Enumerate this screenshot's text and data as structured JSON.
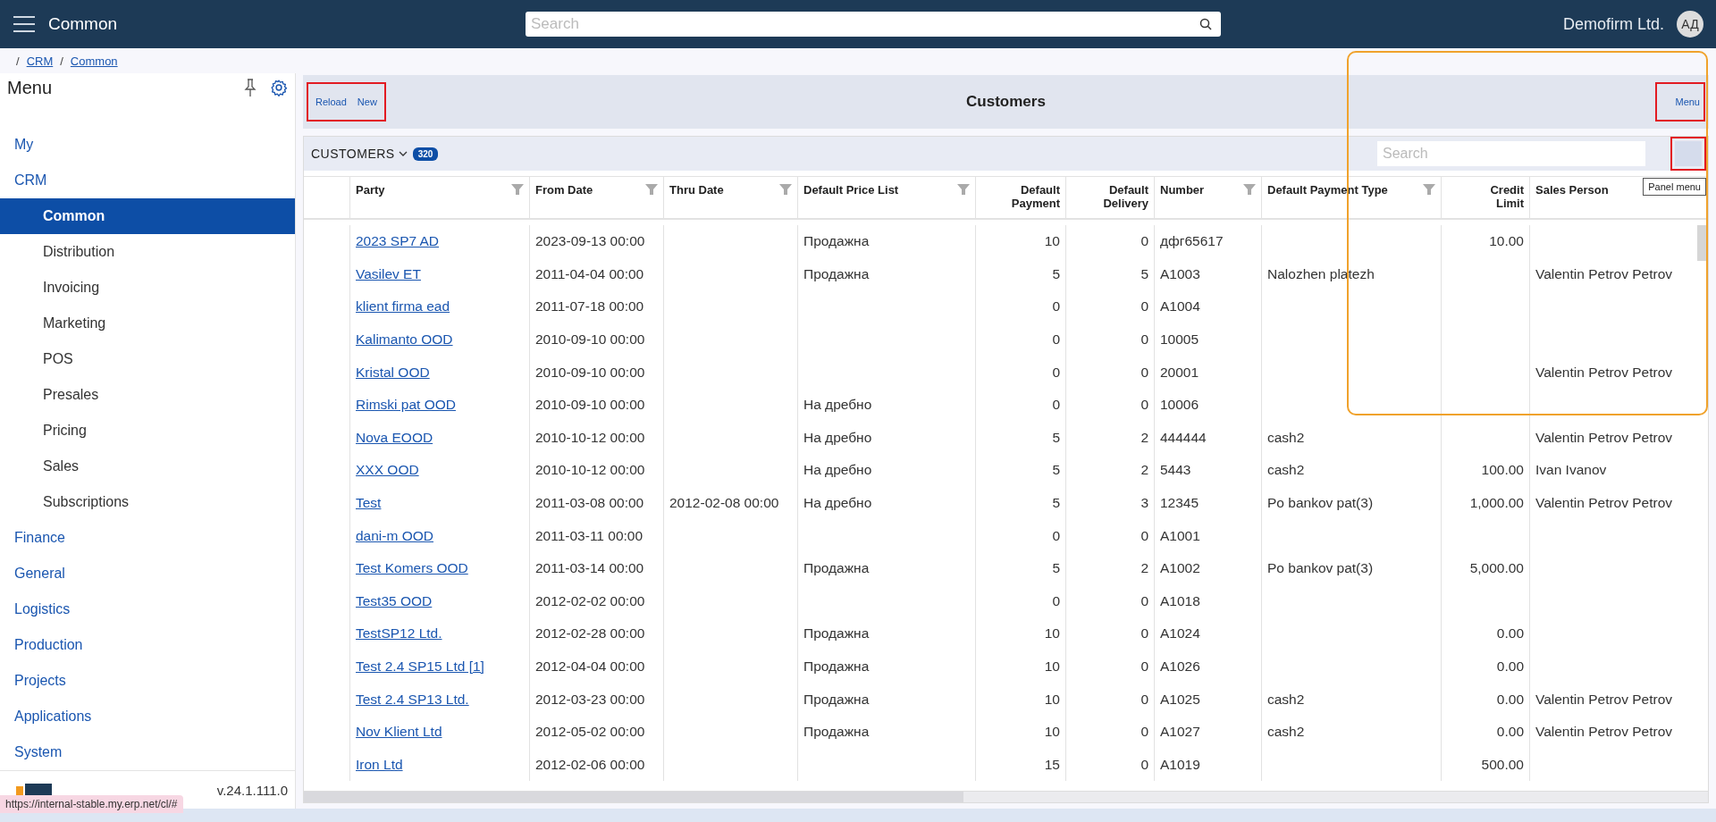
{
  "topbar": {
    "title": "Common",
    "search_placeholder": "Search",
    "company": "Demofirm Ltd.",
    "avatar": "АД"
  },
  "breadcrumb": {
    "separator": "/",
    "items": [
      "CRM",
      "Common"
    ]
  },
  "sidebar": {
    "title": "Menu",
    "items": [
      {
        "label": "My",
        "selected": false
      },
      {
        "label": "CRM",
        "selected": false,
        "children": [
          {
            "label": "Common",
            "selected": true
          },
          {
            "label": "Distribution",
            "selected": false
          },
          {
            "label": "Invoicing",
            "selected": false
          },
          {
            "label": "Marketing",
            "selected": false
          },
          {
            "label": "POS",
            "selected": false
          },
          {
            "label": "Presales",
            "selected": false
          },
          {
            "label": "Pricing",
            "selected": false
          },
          {
            "label": "Sales",
            "selected": false
          },
          {
            "label": "Subscriptions",
            "selected": false
          }
        ]
      },
      {
        "label": "Finance",
        "selected": false
      },
      {
        "label": "General",
        "selected": false
      },
      {
        "label": "Logistics",
        "selected": false
      },
      {
        "label": "Production",
        "selected": false
      },
      {
        "label": "Projects",
        "selected": false
      },
      {
        "label": "Applications",
        "selected": false
      },
      {
        "label": "System",
        "selected": false
      }
    ],
    "version": "v.24.1.111.0"
  },
  "status_url": "https://internal-stable.my.erp.net/cl/#",
  "toolbar": {
    "actions": [
      "Reload",
      "New"
    ],
    "actions_highlighted": true,
    "title": "Customers",
    "menu_button": "Menu",
    "menu_highlighted": true
  },
  "grid": {
    "title": "CUSTOMERS",
    "count": "320",
    "search_placeholder": "Search",
    "panel_menu_highlighted": true,
    "tooltip": "Panel menu",
    "columns": [
      {
        "label": "Party",
        "kind": "link",
        "filter": true
      },
      {
        "label": "From Date",
        "kind": "text",
        "filter": true
      },
      {
        "label": "Thru Date",
        "kind": "text",
        "filter": true
      },
      {
        "label": "Default Price List",
        "kind": "text",
        "filter": true
      },
      {
        "label": "Default Payment",
        "kind": "number",
        "filter": false
      },
      {
        "label": "Default Delivery",
        "kind": "number",
        "filter": false
      },
      {
        "label": "Number",
        "kind": "text",
        "filter": true
      },
      {
        "label": "Default Payment Type",
        "kind": "text",
        "filter": true
      },
      {
        "label": "Credit Limit",
        "kind": "number",
        "filter": false
      },
      {
        "label": "Sales Person",
        "kind": "text",
        "filter": false
      }
    ],
    "rows": [
      [
        "2023 SP7 AD",
        "2023-09-13 00:00",
        null,
        "Продажна",
        "10",
        "0",
        "дфг65617",
        null,
        "10.00",
        null
      ],
      [
        "Vasilev ET",
        "2011-04-04 00:00",
        null,
        "Продажна",
        "5",
        "5",
        "A1003",
        "Nalozhen platezh",
        null,
        "Valentin Petrov Petrov"
      ],
      [
        "klient firma ead",
        "2011-07-18 00:00",
        null,
        null,
        "0",
        "0",
        "A1004",
        null,
        null,
        null
      ],
      [
        "Kalimanto OOD",
        "2010-09-10 00:00",
        null,
        null,
        "0",
        "0",
        "10005",
        null,
        null,
        null
      ],
      [
        "Kristal OOD",
        "2010-09-10 00:00",
        null,
        null,
        "0",
        "0",
        "20001",
        null,
        null,
        "Valentin Petrov Petrov"
      ],
      [
        "Rimski pat OOD",
        "2010-09-10 00:00",
        null,
        "На дребно",
        "0",
        "0",
        "10006",
        null,
        null,
        null
      ],
      [
        "Nova EOOD",
        "2010-10-12 00:00",
        null,
        "На дребно",
        "5",
        "2",
        "444444",
        "cash2",
        null,
        "Valentin Petrov Petrov"
      ],
      [
        "XXX OOD",
        "2010-10-12 00:00",
        null,
        "На дребно",
        "5",
        "2",
        "5443",
        "cash2",
        "100.00",
        "Ivan Ivanov"
      ],
      [
        "Test",
        "2011-03-08 00:00",
        "2012-02-08 00:00",
        "На дребно",
        "5",
        "3",
        "12345",
        "Po bankov pat(3)",
        "1,000.00",
        "Valentin Petrov Petrov"
      ],
      [
        "dani-m OOD",
        "2011-03-11 00:00",
        null,
        null,
        "0",
        "0",
        "A1001",
        null,
        null,
        null
      ],
      [
        "Test Komers OOD",
        "2011-03-14 00:00",
        null,
        "Продажна",
        "5",
        "2",
        "A1002",
        "Po bankov pat(3)",
        "5,000.00",
        null
      ],
      [
        "Test35 OOD",
        "2012-02-02 00:00",
        null,
        null,
        "0",
        "0",
        "A1018",
        null,
        null,
        null
      ],
      [
        "TestSP12 Ltd.",
        "2012-02-28 00:00",
        null,
        "Продажна",
        "10",
        "0",
        "A1024",
        null,
        "0.00",
        null
      ],
      [
        "Test 2.4 SP15 Ltd [1]",
        "2012-04-04 00:00",
        null,
        "Продажна",
        "10",
        "0",
        "A1026",
        null,
        "0.00",
        null
      ],
      [
        "Test 2.4 SP13 Ltd.",
        "2012-03-23 00:00",
        null,
        "Продажна",
        "10",
        "0",
        "A1025",
        "cash2",
        "0.00",
        "Valentin Petrov Petrov"
      ],
      [
        "Nov Klient Ltd",
        "2012-05-02 00:00",
        null,
        "Продажна",
        "10",
        "0",
        "A1027",
        "cash2",
        "0.00",
        "Valentin Petrov Petrov"
      ],
      [
        "Iron Ltd",
        "2012-02-06 00:00",
        null,
        null,
        "15",
        "0",
        "A1019",
        null,
        "500.00",
        null
      ]
    ]
  }
}
